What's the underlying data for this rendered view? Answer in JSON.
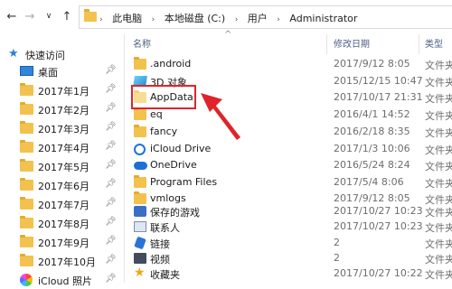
{
  "address_bar": {
    "back_icon": "arrow-left-icon",
    "forward_icon": "arrow-right-icon",
    "dropdown_icon": "chevron-down-icon",
    "up_icon": "arrow-up-icon",
    "breadcrumbs": [
      "此电脑",
      "本地磁盘 (C:)",
      "用户",
      "Administrator"
    ]
  },
  "nav_pane": {
    "quick_access_label": "快速访问",
    "items": [
      {
        "label": "桌面",
        "icon": "desktop-icon",
        "pinned": true
      },
      {
        "label": "2017年1月",
        "icon": "folder-icon",
        "pinned": true
      },
      {
        "label": "2017年2月",
        "icon": "folder-icon",
        "pinned": true
      },
      {
        "label": "2017年3月",
        "icon": "folder-icon",
        "pinned": true
      },
      {
        "label": "2017年4月",
        "icon": "folder-icon",
        "pinned": true
      },
      {
        "label": "2017年5月",
        "icon": "folder-icon",
        "pinned": true
      },
      {
        "label": "2017年6月",
        "icon": "folder-icon",
        "pinned": true
      },
      {
        "label": "2017年7月",
        "icon": "folder-icon",
        "pinned": true
      },
      {
        "label": "2017年8月",
        "icon": "folder-icon",
        "pinned": true
      },
      {
        "label": "2017年9月",
        "icon": "folder-icon",
        "pinned": true
      },
      {
        "label": "2017年10月",
        "icon": "folder-icon",
        "pinned": true
      },
      {
        "label": "iCloud 照片",
        "icon": "icloud-photos-icon",
        "pinned": true
      }
    ]
  },
  "file_list": {
    "columns": [
      "名称",
      "修改日期",
      "类型"
    ],
    "rows": [
      {
        "name": ".android",
        "modified": "2017/9/12 8:05",
        "type": "文件夹",
        "icon": "folder-icon"
      },
      {
        "name": "3D 对象",
        "modified": "2015/12/15 10:47",
        "type": "文件夹",
        "icon": "3d-objects-icon"
      },
      {
        "name": "AppData",
        "modified": "2017/10/17 21:31",
        "type": "文件夹",
        "icon": "folder-icon",
        "highlighted": true
      },
      {
        "name": "eq",
        "modified": "2016/4/1 14:52",
        "type": "文件夹",
        "icon": "folder-icon"
      },
      {
        "name": "fancy",
        "modified": "2016/2/18 8:35",
        "type": "文件夹",
        "icon": "folder-icon"
      },
      {
        "name": "iCloud Drive",
        "modified": "2017/1/3 10:06",
        "type": "文件夹",
        "icon": "icloud-drive-icon"
      },
      {
        "name": "OneDrive",
        "modified": "2016/5/24 8:24",
        "type": "文件夹",
        "icon": "onedrive-icon"
      },
      {
        "name": "Program Files",
        "modified": "2017/5/4 8:06",
        "type": "文件夹",
        "icon": "folder-icon"
      },
      {
        "name": "vmlogs",
        "modified": "2017/9/12 8:05",
        "type": "文件夹",
        "icon": "folder-icon"
      },
      {
        "name": "保存的游戏",
        "modified": "2017/10/27 10:23",
        "type": "文件夹",
        "icon": "saved-games-icon"
      },
      {
        "name": "联系人",
        "modified": "2017/10/27 10:23",
        "type": "文件夹",
        "icon": "contacts-icon"
      },
      {
        "name": "链接",
        "modified": "2",
        "type": "文件夹",
        "icon": "links-icon"
      },
      {
        "name": "视频",
        "modified": "2",
        "type": "文件夹",
        "icon": "videos-icon"
      },
      {
        "name": "收藏夹",
        "modified": "2017/10/27 10:22",
        "type": "文件夹",
        "icon": "favorites-icon"
      }
    ]
  },
  "colors": {
    "highlight_box": "#e0232b",
    "arrow": "#e0232b",
    "header_text": "#4d6082",
    "folder": "#f3c24e"
  }
}
